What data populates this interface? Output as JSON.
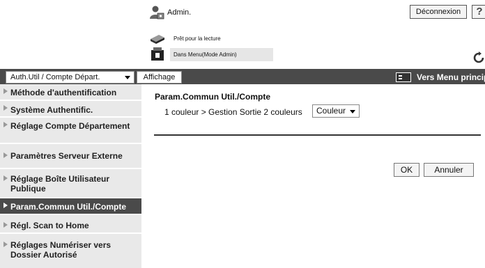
{
  "header": {
    "user": "Admin.",
    "logout_label": "Déconnexion",
    "help_label": "?",
    "status_ready": "Prêt pour la lecture",
    "status_mode": "Dans Menu(Mode Admin)"
  },
  "toolbar": {
    "mode_select": "Auth.Util / Compte Départ.",
    "tab_label": "Affichage",
    "menu_label": "Vers Menu principal"
  },
  "sidebar": {
    "items": [
      {
        "label": "Méthode d'authentification"
      },
      {
        "label": "Système Authentific."
      },
      {
        "label": "Réglage Compte Département"
      },
      {
        "label": "Paramètres Serveur Externe"
      },
      {
        "label": "Réglage Boîte Utilisateur Publique"
      },
      {
        "label": "Param.Commun Util./Compte",
        "active": true
      },
      {
        "label": "Régl. Scan to Home"
      },
      {
        "label": "Réglages Numériser vers Dossier Autorisé"
      }
    ]
  },
  "main": {
    "title": "Param.Commun Util./Compte",
    "setting_label": "1 couleur > Gestion Sortie 2 couleurs",
    "setting_value": "Couleur",
    "ok_label": "OK",
    "cancel_label": "Annuler"
  },
  "colors": {
    "toolbar_bg": "#4a4a4a",
    "sidebar_bg": "#e9e9e9",
    "active_bg": "#4a4a4a"
  }
}
